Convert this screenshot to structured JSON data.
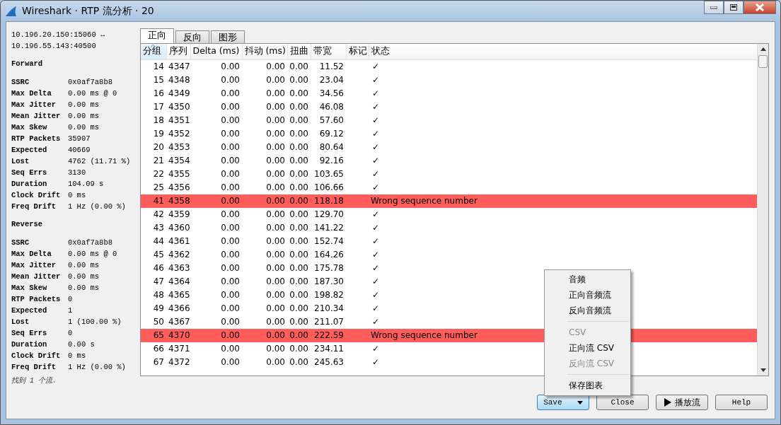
{
  "window": {
    "title": "Wireshark · RTP 流分析 · 20"
  },
  "stream": {
    "line_1": "10.196.20.150:15060 ↔",
    "line_2": "10.196.55.143:40500"
  },
  "sections": [
    {
      "heading": "Forward",
      "stats": [
        {
          "label": "SSRC",
          "value": "0x0af7a8b8"
        },
        {
          "label": "Max Delta",
          "value": "0.00 ms @ 0"
        },
        {
          "label": "Max Jitter",
          "value": "0.00 ms"
        },
        {
          "label": "Mean Jitter",
          "value": "0.00 ms"
        },
        {
          "label": "Max Skew",
          "value": "0.00 ms"
        },
        {
          "label": "RTP Packets",
          "value": "35907"
        },
        {
          "label": "Expected",
          "value": "40669"
        },
        {
          "label": "Lost",
          "value": "4762 (11.71 %)"
        },
        {
          "label": "Seq Errs",
          "value": "3130"
        },
        {
          "label": "Duration",
          "value": "104.09 s"
        },
        {
          "label": "Clock Drift",
          "value": "0 ms"
        },
        {
          "label": "Freq Drift",
          "value": "1 Hz (0.00 %)"
        }
      ]
    },
    {
      "heading": "Reverse",
      "stats": [
        {
          "label": "SSRC",
          "value": "0x0af7a8b8"
        },
        {
          "label": "Max Delta",
          "value": "0.00 ms @ 0"
        },
        {
          "label": "Max Jitter",
          "value": "0.00 ms"
        },
        {
          "label": "Mean Jitter",
          "value": "0.00 ms"
        },
        {
          "label": "Max Skew",
          "value": "0.00 ms"
        },
        {
          "label": "RTP Packets",
          "value": "0"
        },
        {
          "label": "Expected",
          "value": "1"
        },
        {
          "label": "Lost",
          "value": "1 (100.00 %)"
        },
        {
          "label": "Seq Errs",
          "value": "0"
        },
        {
          "label": "Duration",
          "value": "0.00 s"
        },
        {
          "label": "Clock Drift",
          "value": "0 ms"
        },
        {
          "label": "Freq Drift",
          "value": "1 Hz (0.00 %)"
        }
      ]
    }
  ],
  "found_note": "找到 1 个流.",
  "tabs": [
    {
      "label": "正向",
      "selected": true
    },
    {
      "label": "反向",
      "selected": false
    },
    {
      "label": "图形",
      "selected": false
    }
  ],
  "table": {
    "columns": [
      "分组",
      "序列",
      "Delta (ms)",
      "抖动 (ms)",
      "扭曲",
      "带宽",
      "标记",
      "状态"
    ],
    "rows": [
      {
        "kind": "ok",
        "packet": "14",
        "seq": "4347",
        "delta": "0.00",
        "jitter": "0.00",
        "skew": "0.00",
        "bandwidth": "11.52",
        "status": "✓"
      },
      {
        "kind": "ok",
        "packet": "15",
        "seq": "4348",
        "delta": "0.00",
        "jitter": "0.00",
        "skew": "0.00",
        "bandwidth": "23.04",
        "status": "✓"
      },
      {
        "kind": "ok",
        "packet": "16",
        "seq": "4349",
        "delta": "0.00",
        "jitter": "0.00",
        "skew": "0.00",
        "bandwidth": "34.56",
        "status": "✓"
      },
      {
        "kind": "ok",
        "packet": "17",
        "seq": "4350",
        "delta": "0.00",
        "jitter": "0.00",
        "skew": "0.00",
        "bandwidth": "46.08",
        "status": "✓"
      },
      {
        "kind": "ok",
        "packet": "18",
        "seq": "4351",
        "delta": "0.00",
        "jitter": "0.00",
        "skew": "0.00",
        "bandwidth": "57.60",
        "status": "✓"
      },
      {
        "kind": "ok",
        "packet": "19",
        "seq": "4352",
        "delta": "0.00",
        "jitter": "0.00",
        "skew": "0.00",
        "bandwidth": "69.12",
        "status": "✓"
      },
      {
        "kind": "ok",
        "packet": "20",
        "seq": "4353",
        "delta": "0.00",
        "jitter": "0.00",
        "skew": "0.00",
        "bandwidth": "80.64",
        "status": "✓"
      },
      {
        "kind": "ok",
        "packet": "21",
        "seq": "4354",
        "delta": "0.00",
        "jitter": "0.00",
        "skew": "0.00",
        "bandwidth": "92.16",
        "status": "✓"
      },
      {
        "kind": "ok",
        "packet": "22",
        "seq": "4355",
        "delta": "0.00",
        "jitter": "0.00",
        "skew": "0.00",
        "bandwidth": "103.65",
        "status": "✓"
      },
      {
        "kind": "ok",
        "packet": "25",
        "seq": "4356",
        "delta": "0.00",
        "jitter": "0.00",
        "skew": "0.00",
        "bandwidth": "106.66",
        "status": "✓"
      },
      {
        "kind": "error",
        "packet": "41",
        "seq": "4358",
        "delta": "0.00",
        "jitter": "0.00",
        "skew": "0.00",
        "bandwidth": "118.18",
        "status": "Wrong sequence number"
      },
      {
        "kind": "ok",
        "packet": "42",
        "seq": "4359",
        "delta": "0.00",
        "jitter": "0.00",
        "skew": "0.00",
        "bandwidth": "129.70",
        "status": "✓"
      },
      {
        "kind": "ok",
        "packet": "43",
        "seq": "4360",
        "delta": "0.00",
        "jitter": "0.00",
        "skew": "0.00",
        "bandwidth": "141.22",
        "status": "✓"
      },
      {
        "kind": "ok",
        "packet": "44",
        "seq": "4361",
        "delta": "0.00",
        "jitter": "0.00",
        "skew": "0.00",
        "bandwidth": "152.74",
        "status": "✓"
      },
      {
        "kind": "ok",
        "packet": "45",
        "seq": "4362",
        "delta": "0.00",
        "jitter": "0.00",
        "skew": "0.00",
        "bandwidth": "164.26",
        "status": "✓"
      },
      {
        "kind": "ok",
        "packet": "46",
        "seq": "4363",
        "delta": "0.00",
        "jitter": "0.00",
        "skew": "0.00",
        "bandwidth": "175.78",
        "status": "✓"
      },
      {
        "kind": "ok",
        "packet": "47",
        "seq": "4364",
        "delta": "0.00",
        "jitter": "0.00",
        "skew": "0.00",
        "bandwidth": "187.30",
        "status": "✓"
      },
      {
        "kind": "ok",
        "packet": "48",
        "seq": "4365",
        "delta": "0.00",
        "jitter": "0.00",
        "skew": "0.00",
        "bandwidth": "198.82",
        "status": "✓"
      },
      {
        "kind": "ok",
        "packet": "49",
        "seq": "4366",
        "delta": "0.00",
        "jitter": "0.00",
        "skew": "0.00",
        "bandwidth": "210.34",
        "status": "✓"
      },
      {
        "kind": "ok",
        "packet": "50",
        "seq": "4367",
        "delta": "0.00",
        "jitter": "0.00",
        "skew": "0.00",
        "bandwidth": "211.07",
        "status": "✓"
      },
      {
        "kind": "error",
        "packet": "65",
        "seq": "4370",
        "delta": "0.00",
        "jitter": "0.00",
        "skew": "0.00",
        "bandwidth": "222.59",
        "status": "Wrong sequence number"
      },
      {
        "kind": "ok",
        "packet": "66",
        "seq": "4371",
        "delta": "0.00",
        "jitter": "0.00",
        "skew": "0.00",
        "bandwidth": "234.11",
        "status": "✓"
      },
      {
        "kind": "ok",
        "packet": "67",
        "seq": "4372",
        "delta": "0.00",
        "jitter": "0.00",
        "skew": "0.00",
        "bandwidth": "245.63",
        "status": "✓"
      }
    ]
  },
  "save_menu": {
    "groups": [
      [
        {
          "label": "音频",
          "disabled": false
        },
        {
          "label": "正向音频流",
          "disabled": false
        },
        {
          "label": "反向音频流",
          "disabled": false
        }
      ],
      [
        {
          "label": "CSV",
          "disabled": true
        },
        {
          "label": "正向流 CSV",
          "disabled": false
        },
        {
          "label": "反向流 CSV",
          "disabled": true
        }
      ],
      [
        {
          "label": "保存图表",
          "disabled": false
        }
      ]
    ]
  },
  "buttons": [
    {
      "kind": "dropdown",
      "label": "Save",
      "selected": true
    },
    {
      "kind": "plain",
      "label": "Close",
      "selected": false
    },
    {
      "kind": "play",
      "label": "播放流",
      "selected": false
    },
    {
      "kind": "plain",
      "label": "Help",
      "selected": false
    }
  ]
}
